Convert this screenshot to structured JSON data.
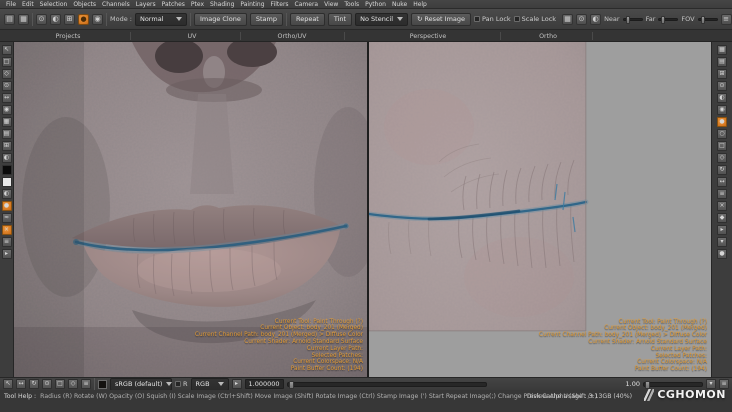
{
  "colors": {
    "accent": "#e08428",
    "hud_text": "#e09a35",
    "mouth_line": "#2d5f7e",
    "canvas_gray": "#9e9e9e"
  },
  "menu": {
    "items": [
      "File",
      "Edit",
      "Selection",
      "Objects",
      "Channels",
      "Layers",
      "Patches",
      "Ptex",
      "Shading",
      "Painting",
      "Filters",
      "Camera",
      "View",
      "Tools",
      "Python",
      "Nuke",
      "Help"
    ]
  },
  "toolbar": {
    "mode_label": "Mode :",
    "mode_value": "Normal",
    "image_clone": "Image Clone",
    "stamp": "Stamp",
    "repeat": "Repeat",
    "tint": "Tint",
    "stencil_value": "No Stencil",
    "reset_image": "Reset Image",
    "pan_lock": "Pan Lock",
    "scale_lock": "Scale Lock",
    "near_label": "Near",
    "far_label": "Far",
    "fov_label": "FOV"
  },
  "tabs": {
    "projects": "Projects",
    "uv": "UV",
    "ortho_uv": "Ortho/UV",
    "perspective": "Perspective",
    "ortho": "Ortho"
  },
  "hud": {
    "lines": [
      "Current Tool: Paint Through (?)",
      "Current Object: body_201 (Merged)",
      "Current Channel Path: body_201 (Merged) > Diffuse Color",
      "Current Shader: Arnold Standard Surface",
      "Current Layer Path:",
      "Selected Patches:",
      "Current Colorspace: N/A",
      "Paint Buffer Count: (194)"
    ]
  },
  "status": {
    "colorspace_value": "sRGB (default)",
    "channel_r_label": "R",
    "display_mode_value": "RGB",
    "value1": "1.000000",
    "value2": "1.00"
  },
  "help": {
    "prefix": "Tool Help :",
    "text": "Radius (R)   Rotate (W)   Opacity (O)   Squish (I)   Scale Image (Ctrl+Shift)   Move Image (Shift)   Rotate Image (Ctrl)   Stamp Image (')   Start Repeat Image(;)   Change Preview Alpha (Shift /+)"
  },
  "footer": {
    "disk_cache": "Disk Cache Usage : 3.13GB (40%)",
    "watermark": "CGHOMON"
  },
  "icons": {
    "toolbar_left": [
      "▤",
      "▦"
    ],
    "toolbar_paint": [
      "⊙",
      "◐",
      "⊞",
      "●",
      "◉"
    ],
    "toolbar_right": [
      "▦",
      "⊙",
      "◐"
    ],
    "toolbar_end": [
      "≡",
      "×"
    ],
    "left_strip": [
      "↖",
      "□",
      "◇",
      "⊙",
      "↔",
      "◉",
      "▦",
      "▤",
      "⊞",
      "◐",
      "",
      "",
      "◐",
      "●",
      "≈",
      "×",
      "≡",
      "▸"
    ],
    "right_strip": [
      "▦",
      "▤",
      "⊞",
      "⊙",
      "◐",
      "◉",
      "●",
      "○",
      "□",
      "◇",
      "↻",
      "↔",
      "≡",
      "×",
      "◆",
      "▸",
      "▾",
      "●"
    ],
    "status_strip": [
      "↖",
      "↔",
      "↻",
      "⊙",
      "□",
      "◇",
      "≡"
    ],
    "status_end": [
      "▸",
      "▾",
      "≡"
    ],
    "reset_dot": "↻"
  }
}
